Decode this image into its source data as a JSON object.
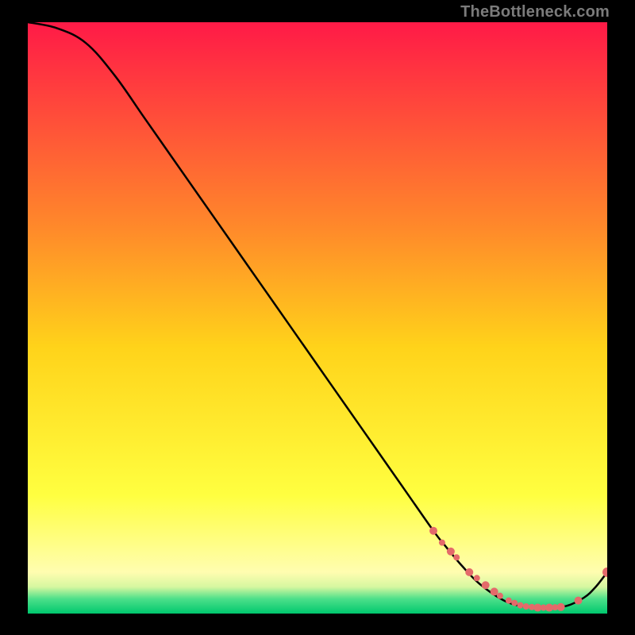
{
  "watermark": "TheBottleneck.com",
  "colors": {
    "background": "#000000",
    "curve": "#000000",
    "marker": "#e46a6a",
    "gradient_stops": [
      {
        "offset": 0.0,
        "color": "#ff1a47"
      },
      {
        "offset": 0.35,
        "color": "#ff8a2a"
      },
      {
        "offset": 0.55,
        "color": "#ffd31a"
      },
      {
        "offset": 0.8,
        "color": "#ffff40"
      },
      {
        "offset": 0.93,
        "color": "#fffdb0"
      },
      {
        "offset": 0.955,
        "color": "#d6f7a0"
      },
      {
        "offset": 0.975,
        "color": "#4de08a"
      },
      {
        "offset": 1.0,
        "color": "#00c86e"
      }
    ]
  },
  "chart_data": {
    "type": "line",
    "title": "",
    "xlabel": "",
    "ylabel": "",
    "xlim": [
      0,
      100
    ],
    "ylim": [
      0,
      100
    ],
    "curve": {
      "x": [
        0,
        5,
        10,
        15,
        20,
        25,
        30,
        35,
        40,
        45,
        50,
        55,
        60,
        65,
        70,
        72,
        75,
        78,
        82,
        85,
        88,
        90,
        93,
        96,
        98,
        100
      ],
      "y": [
        100,
        99,
        96.5,
        91,
        84,
        77,
        70,
        63,
        56,
        49,
        42,
        35,
        28,
        21,
        14,
        11.5,
        8,
        5,
        2.3,
        1.3,
        1.0,
        1.0,
        1.3,
        2.7,
        4.5,
        7
      ]
    },
    "series": [
      {
        "name": "markers",
        "x": [
          70,
          71.5,
          73,
          74,
          76.2,
          77.5,
          79,
          80.5,
          81.5,
          83,
          84,
          85,
          86,
          87,
          88,
          89,
          90,
          91,
          92,
          95,
          100
        ],
        "y": [
          14,
          12,
          10.5,
          9.5,
          7,
          6,
          4.8,
          3.7,
          3.0,
          2.2,
          1.8,
          1.4,
          1.2,
          1.1,
          1.0,
          1.0,
          1.0,
          1.05,
          1.1,
          2.2,
          7
        ],
        "size": [
          5,
          4,
          5,
          4,
          5,
          4,
          5,
          5,
          4,
          4,
          4,
          4,
          4,
          4,
          5,
          4,
          5,
          4,
          5,
          5,
          6
        ]
      }
    ]
  }
}
